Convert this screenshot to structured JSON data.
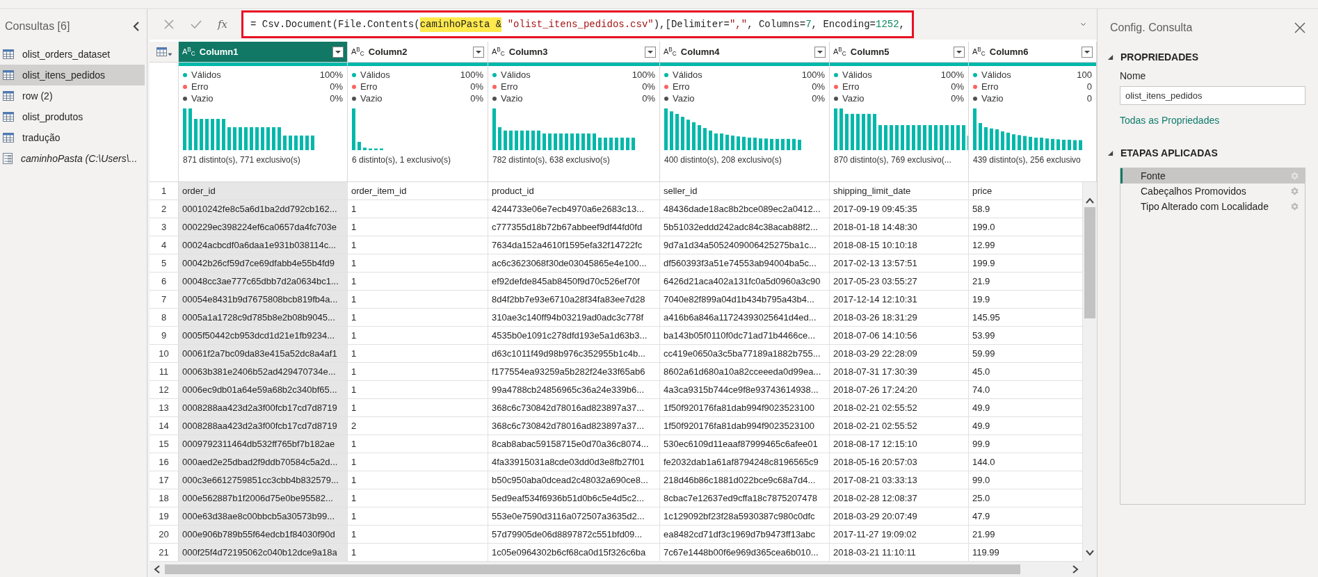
{
  "queries_panel": {
    "title": "Consultas [6]",
    "items": [
      {
        "label": "olist_orders_dataset",
        "selected": false,
        "kind": "table"
      },
      {
        "label": "olist_itens_pedidos",
        "selected": true,
        "kind": "table"
      },
      {
        "label": "row (2)",
        "selected": false,
        "kind": "table"
      },
      {
        "label": "olist_produtos",
        "selected": false,
        "kind": "table"
      },
      {
        "label": "tradução",
        "selected": false,
        "kind": "table"
      },
      {
        "label": "caminhoPasta (C:\\Users\\...",
        "selected": false,
        "kind": "parameter"
      }
    ]
  },
  "formula_bar": {
    "fx_label": "fx",
    "segments": [
      {
        "text": "= Csv.Document(File.Contents(",
        "kind": "plain"
      },
      {
        "text": "caminhoPasta &",
        "kind": "highlight"
      },
      {
        "text": " \"olist_itens_pedidos.csv\"",
        "kind": "string"
      },
      {
        "text": "),[Delimiter=",
        "kind": "plain"
      },
      {
        "text": "\",\"",
        "kind": "string"
      },
      {
        "text": ", Columns=",
        "kind": "plain"
      },
      {
        "text": "7",
        "kind": "number"
      },
      {
        "text": ", Encoding=",
        "kind": "plain"
      },
      {
        "text": "1252",
        "kind": "number"
      },
      {
        "text": ",",
        "kind": "plain"
      }
    ]
  },
  "table": {
    "columns": [
      {
        "name": "Column1",
        "type_label": "A$^{B}$$_{C}$",
        "selected": true,
        "stats": [
          {
            "label": "Válidos",
            "value": "100%",
            "color": "#01b8aa"
          },
          {
            "label": "Erro",
            "value": "0%",
            "color": "#fd625e"
          },
          {
            "label": "Vazio",
            "value": "0%",
            "color": "#505050"
          }
        ],
        "summary": "871 distinto(s), 771 exclusivo(s)"
      },
      {
        "name": "Column2",
        "type_label": "A$^{B}$$_{C}$",
        "selected": false,
        "stats": [
          {
            "label": "Válidos",
            "value": "100%",
            "color": "#01b8aa"
          },
          {
            "label": "Erro",
            "value": "0%",
            "color": "#fd625e"
          },
          {
            "label": "Vazio",
            "value": "0%",
            "color": "#505050"
          }
        ],
        "summary": "6 distinto(s), 1 exclusivo(s)"
      },
      {
        "name": "Column3",
        "type_label": "A$^{B}$$_{C}$",
        "selected": false,
        "stats": [
          {
            "label": "Válidos",
            "value": "100%",
            "color": "#01b8aa"
          },
          {
            "label": "Erro",
            "value": "0%",
            "color": "#fd625e"
          },
          {
            "label": "Vazio",
            "value": "0%",
            "color": "#505050"
          }
        ],
        "summary": "782 distinto(s), 638 exclusivo(s)"
      },
      {
        "name": "Column4",
        "type_label": "A$^{B}$$_{C}$",
        "selected": false,
        "stats": [
          {
            "label": "Válidos",
            "value": "100%",
            "color": "#01b8aa"
          },
          {
            "label": "Erro",
            "value": "0%",
            "color": "#fd625e"
          },
          {
            "label": "Vazio",
            "value": "0%",
            "color": "#505050"
          }
        ],
        "summary": "400 distinto(s), 208 exclusivo(s)"
      },
      {
        "name": "Column5",
        "type_label": "A$^{B}$$_{C}$",
        "selected": false,
        "stats": [
          {
            "label": "Válidos",
            "value": "100%",
            "color": "#01b8aa"
          },
          {
            "label": "Erro",
            "value": "0%",
            "color": "#fd625e"
          },
          {
            "label": "Vazio",
            "value": "0%",
            "color": "#505050"
          }
        ],
        "summary": "870 distinto(s), 769 exclusivo(..."
      },
      {
        "name": "Column6",
        "type_label": "A$^{B}$$_{C}$",
        "selected": false,
        "stats": [
          {
            "label": "Válidos",
            "value": "100",
            "color": "#01b8aa"
          },
          {
            "label": "Erro",
            "value": "0",
            "color": "#fd625e"
          },
          {
            "label": "Vazio",
            "value": "0",
            "color": "#505050"
          }
        ],
        "summary": "439 distinto(s), 256 exclusivo"
      }
    ],
    "rows": [
      {
        "number": "1",
        "cells": [
          "order_id",
          "order_item_id",
          "product_id",
          "seller_id",
          "shipping_limit_date",
          "price"
        ]
      },
      {
        "number": "2",
        "cells": [
          "00010242fe8c5a6d1ba2dd792cb162...",
          "1",
          "4244733e06e7ecb4970a6e2683c13...",
          "48436dade18ac8b2bce089ec2a0412...",
          "2017-09-19 09:45:35",
          "58.9"
        ]
      },
      {
        "number": "3",
        "cells": [
          "000229ec398224ef6ca0657da4fc703e",
          "1",
          "c777355d18b72b67abbeef9df44fd0fd",
          "5b51032eddd242adc84c38acab88f2...",
          "2018-01-18 14:48:30",
          "199.0"
        ]
      },
      {
        "number": "4",
        "cells": [
          "00024acbcdf0a6daa1e931b038114c...",
          "1",
          "7634da152a4610f1595efa32f14722fc",
          "9d7a1d34a5052409006425275ba1c...",
          "2018-08-15 10:10:18",
          "12.99"
        ]
      },
      {
        "number": "5",
        "cells": [
          "00042b26cf59d7ce69dfabb4e55b4fd9",
          "1",
          "ac6c3623068f30de03045865e4e100...",
          "df560393f3a51e74553ab94004ba5c...",
          "2017-02-13 13:57:51",
          "199.9"
        ]
      },
      {
        "number": "6",
        "cells": [
          "00048cc3ae777c65dbb7d2a0634bc1...",
          "1",
          "ef92defde845ab8450f9d70c526ef70f",
          "6426d21aca402a131fc0a5d0960a3c90",
          "2017-05-23 03:55:27",
          "21.9"
        ]
      },
      {
        "number": "7",
        "cells": [
          "00054e8431b9d7675808bcb819fb4a...",
          "1",
          "8d4f2bb7e93e6710a28f34fa83ee7d28",
          "7040e82f899a04d1b434b795a43b4...",
          "2017-12-14 12:10:31",
          "19.9"
        ]
      },
      {
        "number": "8",
        "cells": [
          "0005a1a1728c9d785b8e2b08b9045...",
          "1",
          "310ae3c140ff94b03219ad0adc3c778f",
          "a416b6a846a11724393025641d4ed...",
          "2018-03-26 18:31:29",
          "145.95"
        ]
      },
      {
        "number": "9",
        "cells": [
          "0005f50442cb953dcd1d21e1fb9234...",
          "1",
          "4535b0e1091c278dfd193e5a1d63b3...",
          "ba143b05f0110f0dc71ad71b4466ce...",
          "2018-07-06 14:10:56",
          "53.99"
        ]
      },
      {
        "number": "10",
        "cells": [
          "00061f2a7bc09da83e415a52dc8a4af1",
          "1",
          "d63c1011f49d98b976c352955b1c4b...",
          "cc419e0650a3c5ba77189a1882b755...",
          "2018-03-29 22:28:09",
          "59.99"
        ]
      },
      {
        "number": "11",
        "cells": [
          "00063b381e2406b52ad429470734e...",
          "1",
          "f177554ea93259a5b282f24e33f65ab6",
          "8602a61d680a10a82cceeeda0d99ea...",
          "2018-07-31 17:30:39",
          "45.0"
        ]
      },
      {
        "number": "12",
        "cells": [
          "0006ec9db01a64e59a68b2c340bf65...",
          "1",
          "99a4788cb24856965c36a24e339b6...",
          "4a3ca9315b744ce9f8e93743614938...",
          "2018-07-26 17:24:20",
          "74.0"
        ]
      },
      {
        "number": "13",
        "cells": [
          "0008288aa423d2a3f00fcb17cd7d8719",
          "1",
          "368c6c730842d78016ad823897a37...",
          "1f50f920176fa81dab994f9023523100",
          "2018-02-21 02:55:52",
          "49.9"
        ]
      },
      {
        "number": "14",
        "cells": [
          "0008288aa423d2a3f00fcb17cd7d8719",
          "2",
          "368c6c730842d78016ad823897a37...",
          "1f50f920176fa81dab994f9023523100",
          "2018-02-21 02:55:52",
          "49.9"
        ]
      },
      {
        "number": "15",
        "cells": [
          "0009792311464db532ff765bf7b182ae",
          "1",
          "8cab8abac59158715e0d70a36c8074...",
          "530ec6109d11eaaf87999465c6afee01",
          "2018-08-17 12:15:10",
          "99.9"
        ]
      },
      {
        "number": "16",
        "cells": [
          "000aed2e25dbad2f9ddb70584c5a2d...",
          "1",
          "4fa33915031a8cde03dd0d3e8fb27f01",
          "fe2032dab1a61af8794248c8196565c9",
          "2018-05-16 20:57:03",
          "144.0"
        ]
      },
      {
        "number": "17",
        "cells": [
          "000c3e6612759851cc3cbb4b832579...",
          "1",
          "b50c950aba0dcead2c48032a690ce8...",
          "218d46b86c1881d022bce9c68a7d4...",
          "2017-08-21 03:33:13",
          "99.0"
        ]
      },
      {
        "number": "18",
        "cells": [
          "000e562887b1f2006d75e0be95582...",
          "1",
          "5ed9eaf534f6936b51d0b6c5e4d5c2...",
          "8cbac7e12637ed9cffa18c7875207478",
          "2018-02-28 12:08:37",
          "25.0"
        ]
      },
      {
        "number": "19",
        "cells": [
          "000e63d38ae8c00bbcb5a30573b99...",
          "1",
          "553e0e7590d3116a072507a3635d2...",
          "1c129092bf23f28a5930387c980c0dfc",
          "2018-03-29 20:07:49",
          "47.9"
        ]
      },
      {
        "number": "20",
        "cells": [
          "000e906b789b55f64edcb1f84030f90d",
          "1",
          "57d79905de06d8897872c551bfd09...",
          "ea8482cd71df3c1969d7b9473ff13abc",
          "2017-11-27 19:09:02",
          "21.99"
        ]
      },
      {
        "number": "21",
        "cells": [
          "000f25f4d72195062c040b12dce9a18a",
          "1",
          "1c05e0964302b6cf68ca0d15f326c6ba",
          "7c67e1448b00f6e969d365cea6b010...",
          "2018-03-21 11:10:11",
          "119.99"
        ]
      }
    ]
  },
  "query_settings": {
    "title": "Config. Consulta",
    "properties_heading": "PROPRIEDADES",
    "name_label": "Nome",
    "name_value": "olist_itens_pedidos",
    "all_properties_link": "Todas as Propriedades",
    "steps_heading": "ETAPAS APLICADAS",
    "steps": [
      {
        "label": "Fonte",
        "selected": true
      },
      {
        "label": "Cabeçalhos Promovidos",
        "selected": false
      },
      {
        "label": "Tipo Alterado com Localidade",
        "selected": false
      }
    ]
  }
}
